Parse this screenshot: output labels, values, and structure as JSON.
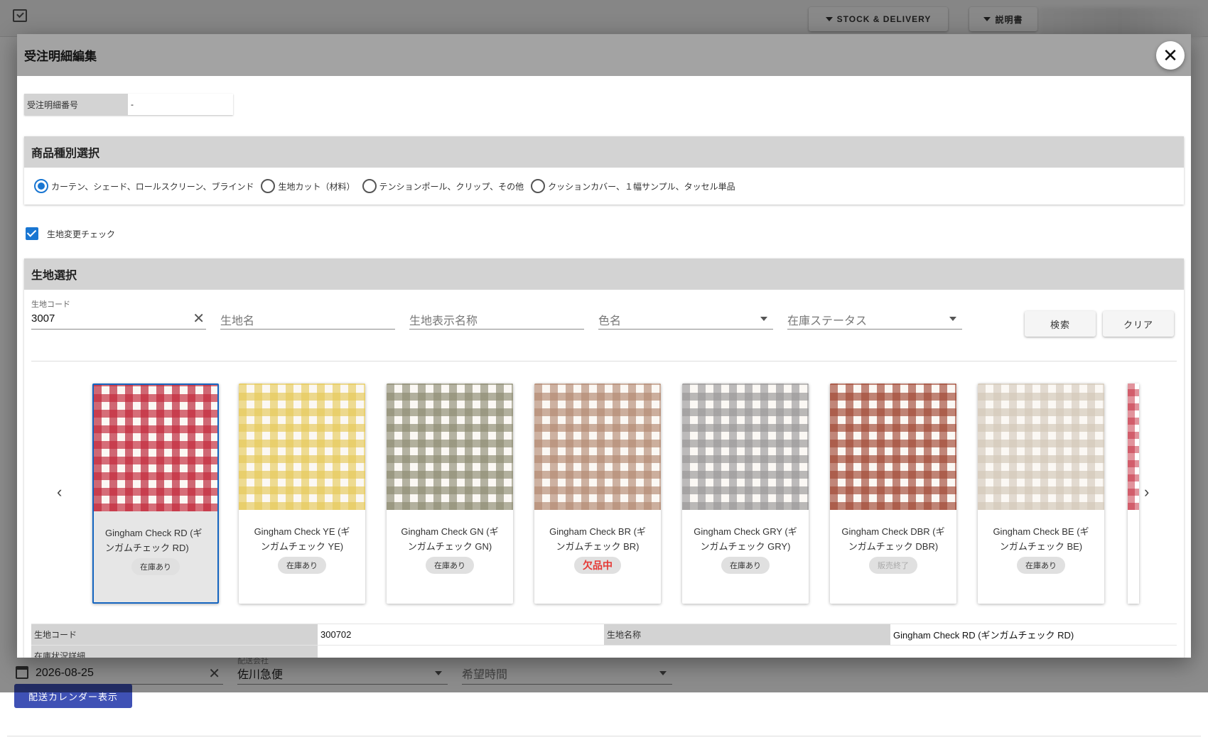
{
  "topbar": {
    "stock_button": "STOCK & DELIVERY",
    "manual_button": "説明書"
  },
  "background": {
    "date_value": "2026-08-25",
    "carrier_label": "配送会社",
    "carrier_value": "佐川急便",
    "time_placeholder": "希望時間",
    "calendar_button": "配送カレンダー表示"
  },
  "modal": {
    "title": "受注明細編集",
    "detail_no_label": "受注明細番号",
    "detail_no_value": "-",
    "product_type": {
      "title": "商品種別選択",
      "options": [
        "カーテン、シェード、ロールスクリーン、ブラインド",
        "生地カット（材料）",
        "テンションポール、クリップ、その他",
        "クッションカバー、１幅サンプル、タッセル単品"
      ],
      "selected_index": 0
    },
    "fabric_change_check": {
      "label": "生地変更チェック",
      "checked": true
    },
    "fabric_select": {
      "title": "生地選択",
      "code_label": "生地コード",
      "code_value": "3007",
      "name_placeholder": "生地名",
      "display_name_placeholder": "生地表示名称",
      "color_placeholder": "色名",
      "stock_status_placeholder": "在庫ステータス",
      "search_button": "検索",
      "clear_button": "クリア"
    },
    "cards": [
      {
        "name": "Gingham Check RD (ギンガムチェック RD)",
        "status": "在庫あり",
        "status_type": "in",
        "color": "#c4283a",
        "selected": true
      },
      {
        "name": "Gingham Check YE (ギンガムチェック YE)",
        "status": "在庫あり",
        "status_type": "in",
        "color": "#e6c95a",
        "selected": false
      },
      {
        "name": "Gingham Check GN (ギンガムチェック GN)",
        "status": "在庫あり",
        "status_type": "in",
        "color": "#8e8c72",
        "selected": false
      },
      {
        "name": "Gingham Check BR (ギンガムチェック BR)",
        "status": "欠品中",
        "status_type": "out",
        "color": "#b48a72",
        "selected": false
      },
      {
        "name": "Gingham Check GRY (ギンガムチェック GRY)",
        "status": "在庫あり",
        "status_type": "in",
        "color": "#9a9898",
        "selected": false
      },
      {
        "name": "Gingham Check DBR (ギンガムチェック DBR)",
        "status": "販売終了",
        "status_type": "end",
        "color": "#a24a36",
        "selected": false
      },
      {
        "name": "Gingham Check BE (ギンガムチェック BE)",
        "status": "在庫あり",
        "status_type": "in",
        "color": "#d3c8b8",
        "selected": false
      }
    ],
    "info": {
      "code_label": "生地コード",
      "code_value": "300702",
      "name_label": "生地名称",
      "name_value": "Gingham Check RD (ギンガムチェック RD)",
      "stock_label": "在庫状況詳細"
    },
    "colors": {
      "accent": "#1976d2",
      "out_of_stock": "#e53935"
    }
  }
}
